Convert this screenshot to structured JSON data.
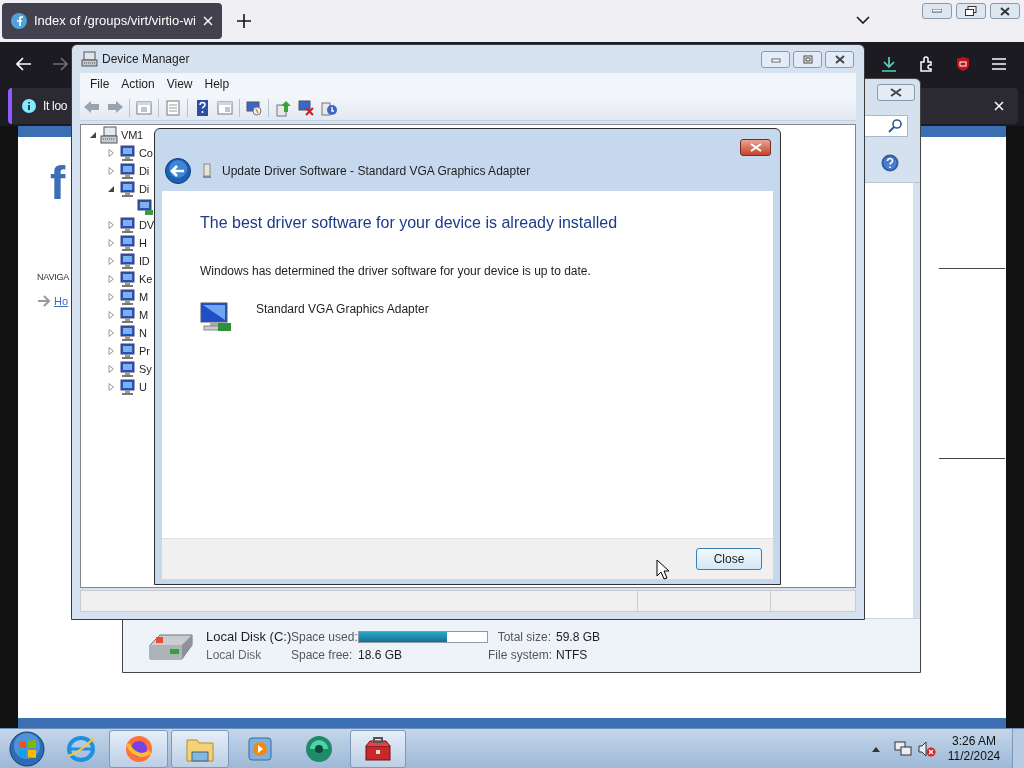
{
  "browser": {
    "tabs": [
      {
        "title": "Index of /groups/virt/virtio-wi",
        "selected": true
      }
    ],
    "notification": {
      "text": "It loo"
    },
    "page": {
      "logo": "f",
      "nav_heading": "NAVIGA",
      "nav_link": "Ho"
    }
  },
  "computer_window": {
    "drive": {
      "name": "Local Disk (C:)",
      "type": "Local Disk",
      "used_label": "Space used:",
      "level": 0.69,
      "free_label": "Space free:",
      "free": "18.6 GB",
      "total_label": "Total size:",
      "total": "59.8 GB",
      "fs_label": "File system:",
      "fs": "NTFS"
    }
  },
  "device_manager": {
    "title": "Device Manager",
    "menu": [
      "File",
      "Action",
      "View",
      "Help"
    ],
    "tree": [
      {
        "label": "VM1",
        "kind": "computer",
        "expanded": true,
        "children": [
          {
            "label": "Co",
            "kind": "category",
            "expanded": false
          },
          {
            "label": "Di",
            "kind": "category",
            "expanded": false
          },
          {
            "label": "Di",
            "kind": "category",
            "expanded": true,
            "children": [
              {
                "kind": "device"
              }
            ]
          },
          {
            "label": "DV",
            "kind": "category",
            "expanded": false
          },
          {
            "label": "H",
            "kind": "category",
            "expanded": false
          },
          {
            "label": "ID",
            "kind": "category",
            "expanded": false
          },
          {
            "label": "Ke",
            "kind": "category",
            "expanded": false
          },
          {
            "label": "M",
            "kind": "category",
            "expanded": false
          },
          {
            "label": "M",
            "kind": "category",
            "expanded": false
          },
          {
            "label": "N",
            "kind": "category",
            "expanded": false
          },
          {
            "label": "Pr",
            "kind": "category",
            "expanded": false
          },
          {
            "label": "Sy",
            "kind": "category",
            "expanded": false
          },
          {
            "label": "U",
            "kind": "category",
            "expanded": false
          }
        ]
      }
    ]
  },
  "dialog": {
    "title": "Update Driver Software - Standard VGA Graphics Adapter",
    "heading": "The best driver software for your device is already installed",
    "message": "Windows has determined the driver software for your device is up to date.",
    "device": "Standard VGA Graphics Adapter",
    "button": "Close"
  },
  "taskbar": {
    "buttons": [
      {
        "kind": "ie",
        "open": false
      },
      {
        "kind": "firefox",
        "open": true
      },
      {
        "kind": "explorer",
        "open": true
      },
      {
        "kind": "media",
        "open": false
      },
      {
        "kind": "disc",
        "open": false
      },
      {
        "kind": "toolbox",
        "open": true
      }
    ],
    "clock": {
      "time": "3:26 AM",
      "date": "11/2/2024"
    }
  }
}
